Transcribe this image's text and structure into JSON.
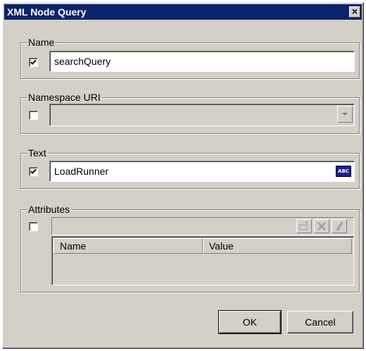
{
  "window": {
    "title": "XML Node Query",
    "close_glyph": "×"
  },
  "name_group": {
    "label": "Name",
    "checked": true,
    "value": "searchQuery"
  },
  "namespace_group": {
    "label": "Namespace URI",
    "checked": false,
    "value": ""
  },
  "text_group": {
    "label": "Text",
    "checked": true,
    "value": "LoadRunner",
    "abc_label": "ABC"
  },
  "attributes_group": {
    "label": "Attributes",
    "checked": false,
    "columns": [
      "Name",
      "Value"
    ],
    "toolbar_icons": [
      "add-icon",
      "delete-icon",
      "edit-icon"
    ]
  },
  "buttons": {
    "ok": "OK",
    "cancel": "Cancel"
  },
  "colors": {
    "titlebar": "#0a246a",
    "face": "#d4d0c8"
  }
}
